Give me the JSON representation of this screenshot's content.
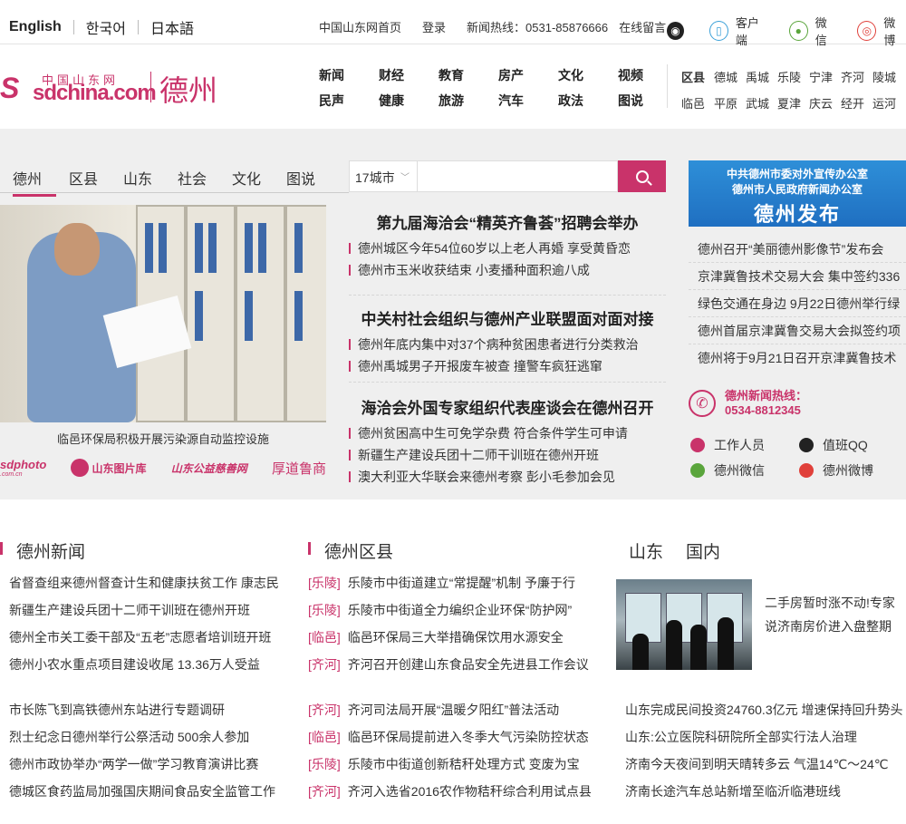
{
  "topbar": {
    "langs": [
      "English",
      "한국어",
      "日本語"
    ],
    "links": [
      "中国山东网首页",
      "登录",
      "新闻热线：0531-85876666",
      "在线留言"
    ],
    "icons": [
      {
        "icon": "qq-icon",
        "label": ""
      },
      {
        "icon": "phone-icon",
        "label": "客户端"
      },
      {
        "icon": "wechat-icon",
        "label": "微信"
      },
      {
        "icon": "weibo-icon",
        "label": "微博"
      }
    ]
  },
  "header": {
    "logo_cn": "中国山东网",
    "logo_domain": "sdchina.com",
    "logo_city": "德州",
    "main_nav": [
      "新闻",
      "财经",
      "教育",
      "房产",
      "文化",
      "视频",
      "民声",
      "健康",
      "旅游",
      "汽车",
      "政法",
      "图说"
    ],
    "county_nav_row1": [
      "区县",
      "德城",
      "禹城",
      "乐陵",
      "宁津",
      "齐河",
      "陵城"
    ],
    "county_nav_row2": [
      "临邑",
      "平原",
      "武城",
      "夏津",
      "庆云",
      "经开",
      "运河"
    ]
  },
  "subnav": [
    "德州",
    "区县",
    "山东",
    "社会",
    "文化",
    "图说"
  ],
  "search": {
    "select_value": "17城市"
  },
  "feature": {
    "caption": "临邑环保局积极开展污染源自动监控设施",
    "partners": [
      "sdphoto",
      "山东图片库",
      "山东公益慈善网",
      "厚道鲁商"
    ],
    "partners_sub": ".com.cn"
  },
  "headlines": [
    {
      "title": "第九届海洽会“精英齐鲁荟”招聘会举办",
      "items": [
        "德州城区今年54位60岁以上老人再婚 享受黄昏恋",
        "德州市玉米收获结束 小麦播种面积逾八成"
      ]
    },
    {
      "title": "中关村社会组织与德州产业联盟面对面对接",
      "items": [
        "德州年底内集中对37个病种贫困患者进行分类救治",
        "德州禹城男子开报废车被查 撞警车疯狂逃窜"
      ]
    },
    {
      "title": "海洽会外国专家组织代表座谈会在德州召开",
      "items": [
        "德州贫困高中生可免学杂费 符合条件学生可申请",
        "新疆生产建设兵团十二师干训班在德州开班",
        "澳大利亚大华联会来德州考察 彭小毛参加会见"
      ]
    }
  ],
  "right": {
    "banner_line1": "中共德州市委对外宣传办公室",
    "banner_line2": "德州市人民政府新闻办公室",
    "banner_title": "德州发布",
    "list": [
      "德州召开“美丽德州影像节”发布会",
      "京津冀鲁技术交易大会 集中签约336",
      "绿色交通在身边 9月22日德州举行绿",
      "德州首届京津冀鲁交易大会拟签约项",
      "德州将于9月21日召开京津冀鲁技术"
    ],
    "hotline_label": "德州新闻热线：",
    "hotline_number": "0534-8812345",
    "contacts": [
      "工作人员",
      "值班QQ",
      "德州微信",
      "德州微博"
    ]
  },
  "sections": {
    "dezhou_news": {
      "title": "德州新闻",
      "list1": [
        "省督查组来德州督查计生和健康扶贫工作 康志民",
        "新疆生产建设兵团十二师干训班在德州开班",
        "德州全市关工委干部及“五老”志愿者培训班开班",
        "德州小农水重点项目建设收尾 13.36万人受益"
      ],
      "list2": [
        "市长陈飞到高铁德州东站进行专题调研",
        "烈士纪念日德州举行公祭活动 500余人参加",
        "德州市政协举办“两学一做”学习教育演讲比赛",
        "德城区食药监局加强国庆期间食品安全监管工作"
      ]
    },
    "county_news": {
      "title": "德州区县",
      "list1": [
        {
          "tag": "[乐陵]",
          "text": "乐陵市中街道建立“常提醒”机制 予廉于行"
        },
        {
          "tag": "[乐陵]",
          "text": "乐陵市中街道全力编织企业环保“防护网”"
        },
        {
          "tag": "[临邑]",
          "text": "临邑环保局三大举措确保饮用水源安全"
        },
        {
          "tag": "[齐河]",
          "text": "齐河召开创建山东食品安全先进县工作会议"
        }
      ],
      "list2": [
        {
          "tag": "[齐河]",
          "text": "齐河司法局开展“温暖夕阳红”普法活动"
        },
        {
          "tag": "[临邑]",
          "text": "临邑环保局提前进入冬季大气污染防控状态"
        },
        {
          "tag": "[乐陵]",
          "text": "乐陵市中街道创新秸秆处理方式 变废为宝"
        },
        {
          "tag": "[齐河]",
          "text": "齐河入选省2016农作物秸秆综合利用试点县"
        }
      ]
    },
    "shandong": {
      "tabs": [
        "山东",
        "国内"
      ],
      "pic_text": "二手房暂时涨不动!专家说济南房价进入盘整期",
      "list2": [
        "山东完成民间投资24760.3亿元 增速保持回升势头",
        "山东:公立医院科研院所全部实行法人治理",
        "济南今天夜间到明天晴转多云 气温14℃～24℃",
        "济南长途汽车总站新增至临沂临港班线"
      ]
    }
  },
  "colors": {
    "accent": "#c9336a",
    "banner_blue": "#2a7fd0"
  }
}
